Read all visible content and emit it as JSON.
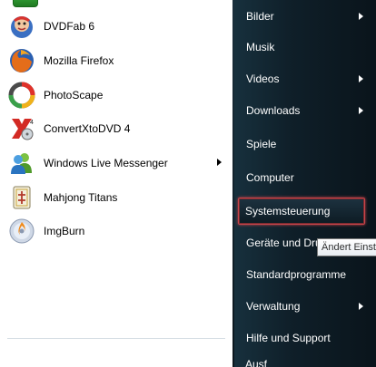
{
  "programs": [
    {
      "label": "DVDFab 6",
      "icon": "dvdfab-icon",
      "has_submenu": false
    },
    {
      "label": "Mozilla Firefox",
      "icon": "firefox-icon",
      "has_submenu": false
    },
    {
      "label": "PhotoScape",
      "icon": "photoscape-icon",
      "has_submenu": false
    },
    {
      "label": "ConvertXtoDVD 4",
      "icon": "convertxtodvd-icon",
      "has_submenu": false
    },
    {
      "label": "Windows Live Messenger",
      "icon": "messenger-icon",
      "has_submenu": true
    },
    {
      "label": "Mahjong Titans",
      "icon": "mahjong-icon",
      "has_submenu": false
    },
    {
      "label": "ImgBurn",
      "icon": "imgburn-icon",
      "has_submenu": false
    }
  ],
  "places": [
    {
      "label": "Bilder",
      "has_submenu": true
    },
    {
      "label": "Musik",
      "has_submenu": false
    },
    {
      "label": "Videos",
      "has_submenu": true
    },
    {
      "label": "Downloads",
      "has_submenu": true
    },
    {
      "label": "Spiele",
      "has_submenu": false
    },
    {
      "label": "Computer",
      "has_submenu": false
    },
    {
      "label": "Systemsteuerung",
      "has_submenu": false,
      "selected": true
    },
    {
      "label": "Geräte und Drucker",
      "has_submenu": false
    },
    {
      "label": "Standardprogramme",
      "has_submenu": false
    },
    {
      "label": "Verwaltung",
      "has_submenu": true
    },
    {
      "label": "Hilfe und Support",
      "has_submenu": false
    }
  ],
  "partial_bottom_label": "Ausf",
  "tooltip": "Ändert Einst",
  "colors": {
    "left_bg": "#ffffff",
    "right_bg": "#0f1f29",
    "selection_border": "#c8444a"
  }
}
